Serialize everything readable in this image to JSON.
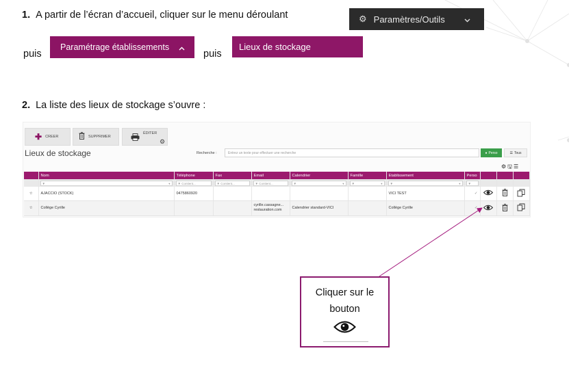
{
  "step1": {
    "number": "1.",
    "text": "A partir de l’écran d’accueil, cliquer sur le menu déroulant",
    "menu_label": "Paramètres/Outils",
    "puis1": "puis",
    "sub_menu_label": "Paramétrage établissements",
    "puis2": "puis",
    "item_label": "Lieux de stockage"
  },
  "step2": {
    "number": "2.",
    "text": "La liste des lieux de stockage s’ouvre :"
  },
  "screen": {
    "toolbar": {
      "create": "CREER",
      "delete": "SUPPRIMER",
      "edit": "ÉDITER"
    },
    "title": "Lieux de stockage",
    "search_label": "Recherche :",
    "search_placeholder": "Entrez un texte pour effectuer une recherche",
    "perso_button": "Perso",
    "tous_button": "Tous",
    "columns": [
      "Nom",
      "Téléphone",
      "Fax",
      "Email",
      "Calendrier",
      "Famille",
      "Etablissement",
      "Perso"
    ],
    "filter_placeholder": "Contient...",
    "rows": [
      {
        "nom": "AJACCIO (STOCK)",
        "telephone": "0475860920",
        "fax": "",
        "email": "",
        "calendrier": "",
        "famille": "",
        "etablissement": "VICI TEST",
        "perso": "✓"
      },
      {
        "nom": "Collège Cyrille",
        "telephone": "",
        "fax": "",
        "email": "cyrille.cassagne... restauration.com",
        "calendrier": "Calendrier standard-VICI",
        "famille": "",
        "etablissement": "Collège Cyrille",
        "perso": "✓"
      }
    ]
  },
  "callout": {
    "text": "Cliquer sur le bouton"
  },
  "colors": {
    "magenta": "#8c1464",
    "dark": "#2b2b2b",
    "green": "#3a9e4a"
  },
  "icons": {
    "gear": "gear-icon",
    "chevron_down": "chevron-down-icon",
    "chevron_up": "chevron-up-icon",
    "plus": "plus-icon",
    "trash": "trash-icon",
    "printer": "printer-icon",
    "eye": "eye-icon",
    "star": "star-icon",
    "copy": "copy-icon"
  }
}
